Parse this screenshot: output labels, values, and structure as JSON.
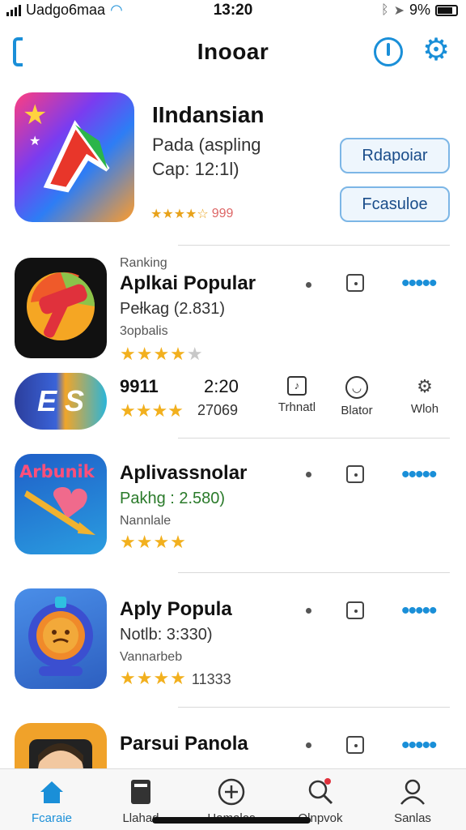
{
  "status": {
    "carrier": "Uadgo6maa",
    "time": "13:20",
    "battery": "9%"
  },
  "header": {
    "title": "Inooar"
  },
  "featured": {
    "name": "IIndansian",
    "line1": "Pada (aspling",
    "line2": "Cap: 12:1l)",
    "rating_count": "999",
    "button1": "Rdapoiar",
    "button2": "Fcasuloe"
  },
  "rows": [
    {
      "small": "Ranking",
      "name": "Aplkai Popular",
      "sub": "Pełkag (2.831)",
      "meta": "3opbalis",
      "stars": "★★★★",
      "stars_gray": "★",
      "count": ""
    },
    {
      "small": "",
      "name": "Aplivassnolar",
      "sub": "Pakhg : 2.580)",
      "meta": "Nannlale",
      "stars": "★★★★",
      "stars_gray": "",
      "count": ""
    },
    {
      "small": "",
      "name": "Aply Popula",
      "sub": "Notlb: 3:330)",
      "meta": "Vannarbeb",
      "stars": "★★★★",
      "stars_gray": "",
      "count": "11333"
    },
    {
      "small": "",
      "name": "Parsui Panola",
      "sub": "",
      "meta": "",
      "stars": "",
      "stars_gray": "",
      "count": ""
    }
  ],
  "es_row": {
    "logo": "E S",
    "value1": "9911",
    "value2": "2:20",
    "count": "27069",
    "actions": [
      "Trhnatl",
      "Blator",
      "Wloh"
    ]
  },
  "icon_art": {
    "row1": "Arbunik"
  },
  "tabs": [
    "Fcaraie",
    "Llahad",
    "Hamalos",
    "Olnpvok",
    "Sanlas"
  ],
  "colors": {
    "accent": "#1a8fd8",
    "star": "#f2b01e"
  }
}
